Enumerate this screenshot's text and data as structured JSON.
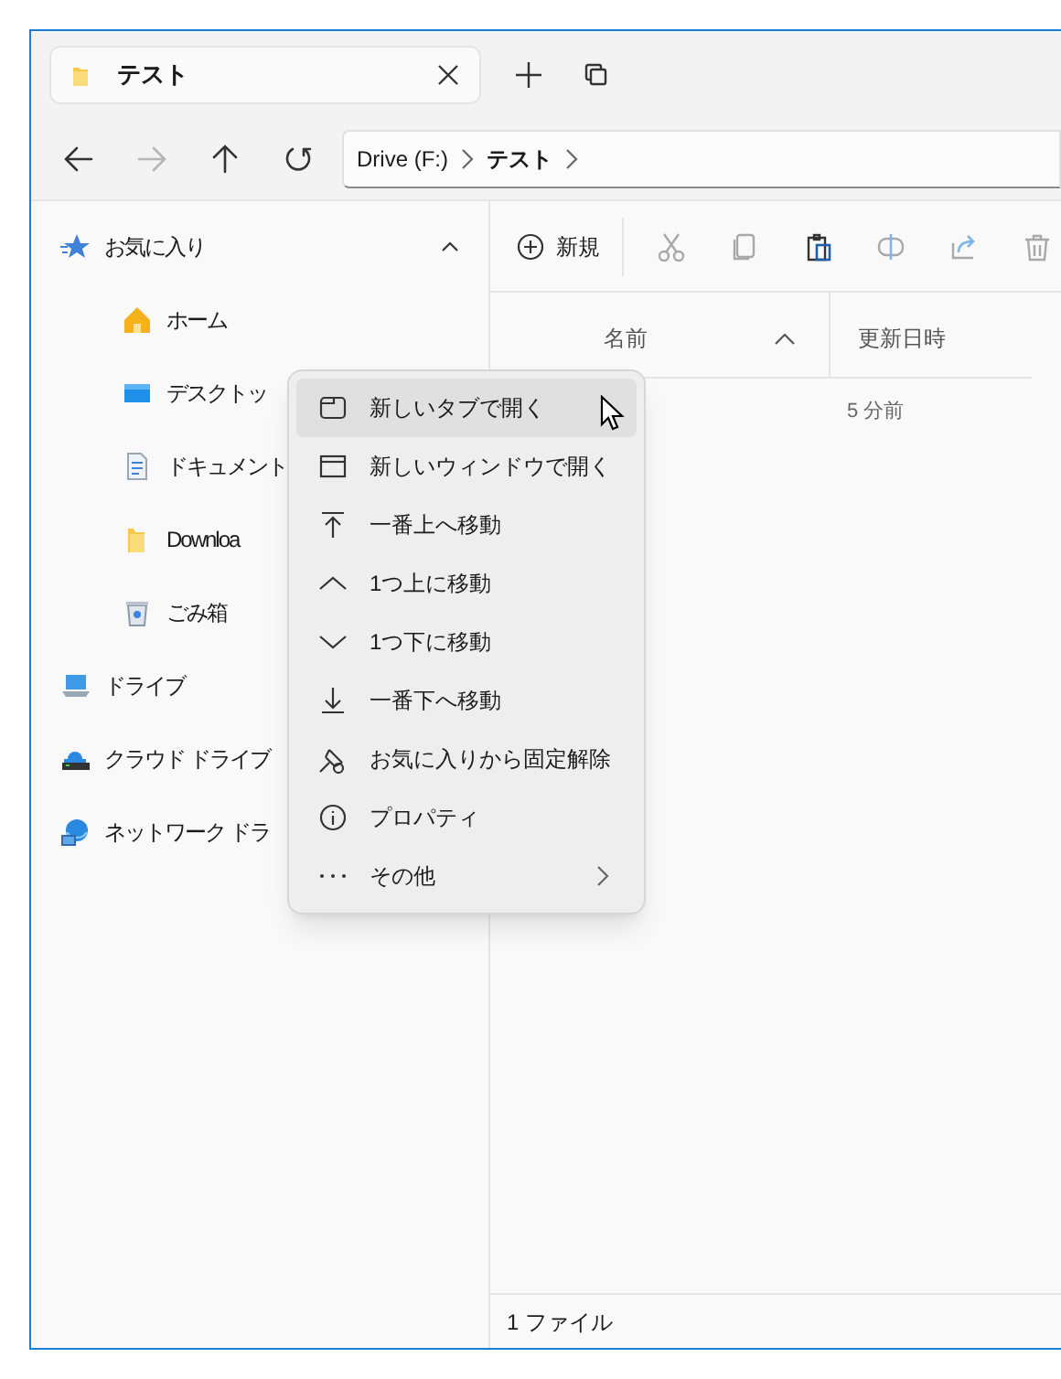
{
  "tab": {
    "title": "テスト"
  },
  "tab_actions": [
    {
      "kind": "plus"
    },
    {
      "kind": "duplicate"
    }
  ],
  "nav": [
    {
      "kind": "back",
      "disabled": false
    },
    {
      "kind": "forward",
      "disabled": true
    },
    {
      "kind": "up",
      "disabled": false
    },
    {
      "kind": "refresh",
      "disabled": false
    }
  ],
  "address": {
    "segments": [
      "Drive (F:)",
      "テスト"
    ]
  },
  "sidebar": {
    "items": [
      {
        "kind": "star",
        "label": "お気に入り",
        "expanded": true,
        "children": [
          {
            "kind": "home",
            "label": "ホーム"
          },
          {
            "kind": "desktop",
            "label": "デスクトッ"
          },
          {
            "kind": "document",
            "label": "ドキュメント"
          },
          {
            "kind": "folder",
            "label": "Downloa"
          },
          {
            "kind": "trash",
            "label": "ごみ箱"
          }
        ]
      },
      {
        "kind": "drive",
        "label": "ドライブ"
      },
      {
        "kind": "cloud",
        "label": "クラウド ドライブ"
      },
      {
        "kind": "network",
        "label": "ネットワーク ドラ"
      }
    ]
  },
  "toolbar": {
    "new_label": "新規",
    "actions": [
      {
        "kind": "cut",
        "disabled": true
      },
      {
        "kind": "copy",
        "disabled": true
      },
      {
        "kind": "paste",
        "disabled": false
      },
      {
        "kind": "rename",
        "disabled": true
      },
      {
        "kind": "share",
        "disabled": true
      },
      {
        "kind": "delete",
        "disabled": true
      }
    ]
  },
  "columns": [
    {
      "label": "名前",
      "sorted": true
    },
    {
      "label": "更新日時",
      "sorted": false
    }
  ],
  "rows": [
    {
      "modified": "5 分前"
    }
  ],
  "status_bar": "1 ファイル",
  "context_menu": [
    {
      "kind": "tab",
      "label": "新しいタブで開く",
      "highlighted": true
    },
    {
      "kind": "window",
      "label": "新しいウィンドウで開く",
      "highlighted": false
    },
    {
      "kind": "top",
      "label": "一番上へ移動",
      "highlighted": false
    },
    {
      "kind": "up",
      "label": "1つ上に移動",
      "highlighted": false
    },
    {
      "kind": "down",
      "label": "1つ下に移動",
      "highlighted": false
    },
    {
      "kind": "bottom",
      "label": "一番下へ移動",
      "highlighted": false
    },
    {
      "kind": "unpin",
      "label": "お気に入りから固定解除",
      "highlighted": false
    },
    {
      "kind": "info",
      "label": "プロパティ",
      "highlighted": false
    },
    {
      "kind": "more",
      "label": "その他",
      "highlighted": false
    }
  ]
}
